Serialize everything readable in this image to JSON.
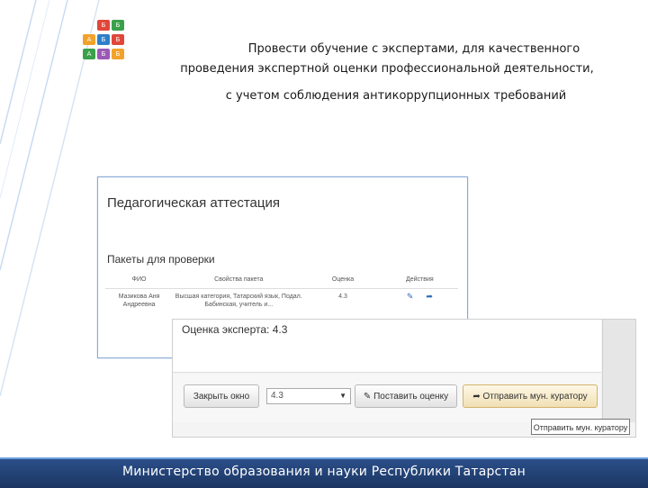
{
  "heading": {
    "line1": "Провести обучение с экспертами, для  качественного",
    "line2": "проведения экспертной оценки профессиональной деятельности,",
    "line3": "с учетом соблюдения  антикоррупционных требований"
  },
  "logo": {
    "tiles": [
      "Б",
      "Б",
      "А",
      "Б",
      "Б",
      "А",
      "Б",
      "Б"
    ]
  },
  "attestation_screen": {
    "page_title": "Педагогическая аттестация",
    "section_title": "Пакеты для проверки",
    "columns": [
      "ФИО",
      "Свойства пакета",
      "Оценка",
      "Действия"
    ],
    "rows": [
      {
        "fio": "Мазикова Аня Андреевна",
        "properties": "Высшая категория, Татарский язык, Подал. Бабинская, учитель и...",
        "score": "4.3",
        "action_icons": [
          "edit-icon",
          "send-icon"
        ]
      }
    ]
  },
  "modal": {
    "score_label": "Оценка эксперта: 4.3",
    "close_button": "Закрыть окно",
    "select_value": "4.3",
    "set_score_button": "Поставить оценку",
    "send_button": "Отправить мун. куратору",
    "tooltip": "Отправить мун. куратору"
  },
  "footer": {
    "text": "Министерство образования и науки Республики Татарстан"
  },
  "colors": {
    "footer_bg": "#1b3561",
    "footer_border": "#6ea0e0",
    "frame_border": "#8aa9d6",
    "send_button_bg": "#f1dfb4"
  }
}
